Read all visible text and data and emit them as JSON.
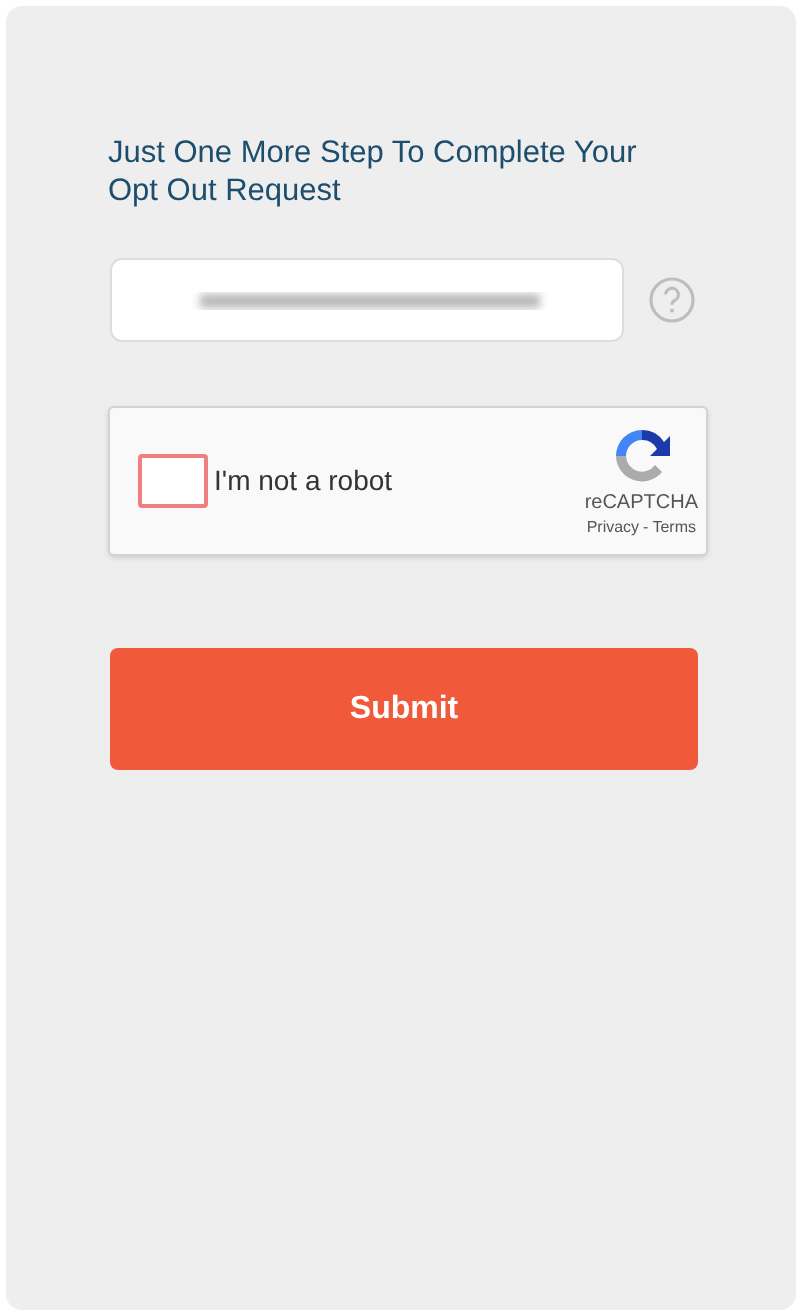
{
  "heading": "Just One More Step To Complete Your Opt Out Request",
  "email_field": {
    "value_obscured": true
  },
  "captcha": {
    "label": "I'm not a robot",
    "checked": false,
    "error": true,
    "brand": "reCAPTCHA",
    "links": [
      "Privacy",
      "Terms"
    ],
    "separator": "-"
  },
  "submit": {
    "label": "Submit"
  }
}
